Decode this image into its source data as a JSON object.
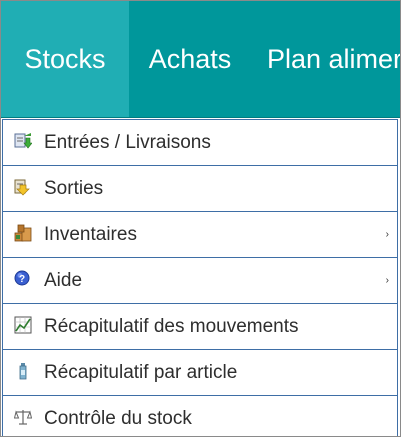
{
  "navbar": {
    "tabs": [
      {
        "label": "Stocks"
      },
      {
        "label": "Achats"
      },
      {
        "label": "Plan alimer"
      }
    ]
  },
  "menu": {
    "items": [
      {
        "label": "Entrées / Livraisons",
        "icon": "incoming-delivery-icon"
      },
      {
        "label": "Sorties",
        "icon": "outgoing-icon"
      },
      {
        "label": "Inventaires",
        "icon": "inventory-boxes-icon",
        "submenu_arrow": "›"
      },
      {
        "label": "Aide",
        "icon": "help-icon",
        "submenu_arrow": "›"
      },
      {
        "label": "Récapitulatif des mouvements",
        "icon": "chart-icon"
      },
      {
        "label": "Récapitulatif par article",
        "icon": "bottle-icon"
      },
      {
        "label": "Contrôle du stock",
        "icon": "scale-icon"
      }
    ]
  },
  "colors": {
    "navbar": "#00979b",
    "active_tab": "#20aeb4",
    "menu_border": "#3e6ea6",
    "text": "#2e2e2e"
  }
}
